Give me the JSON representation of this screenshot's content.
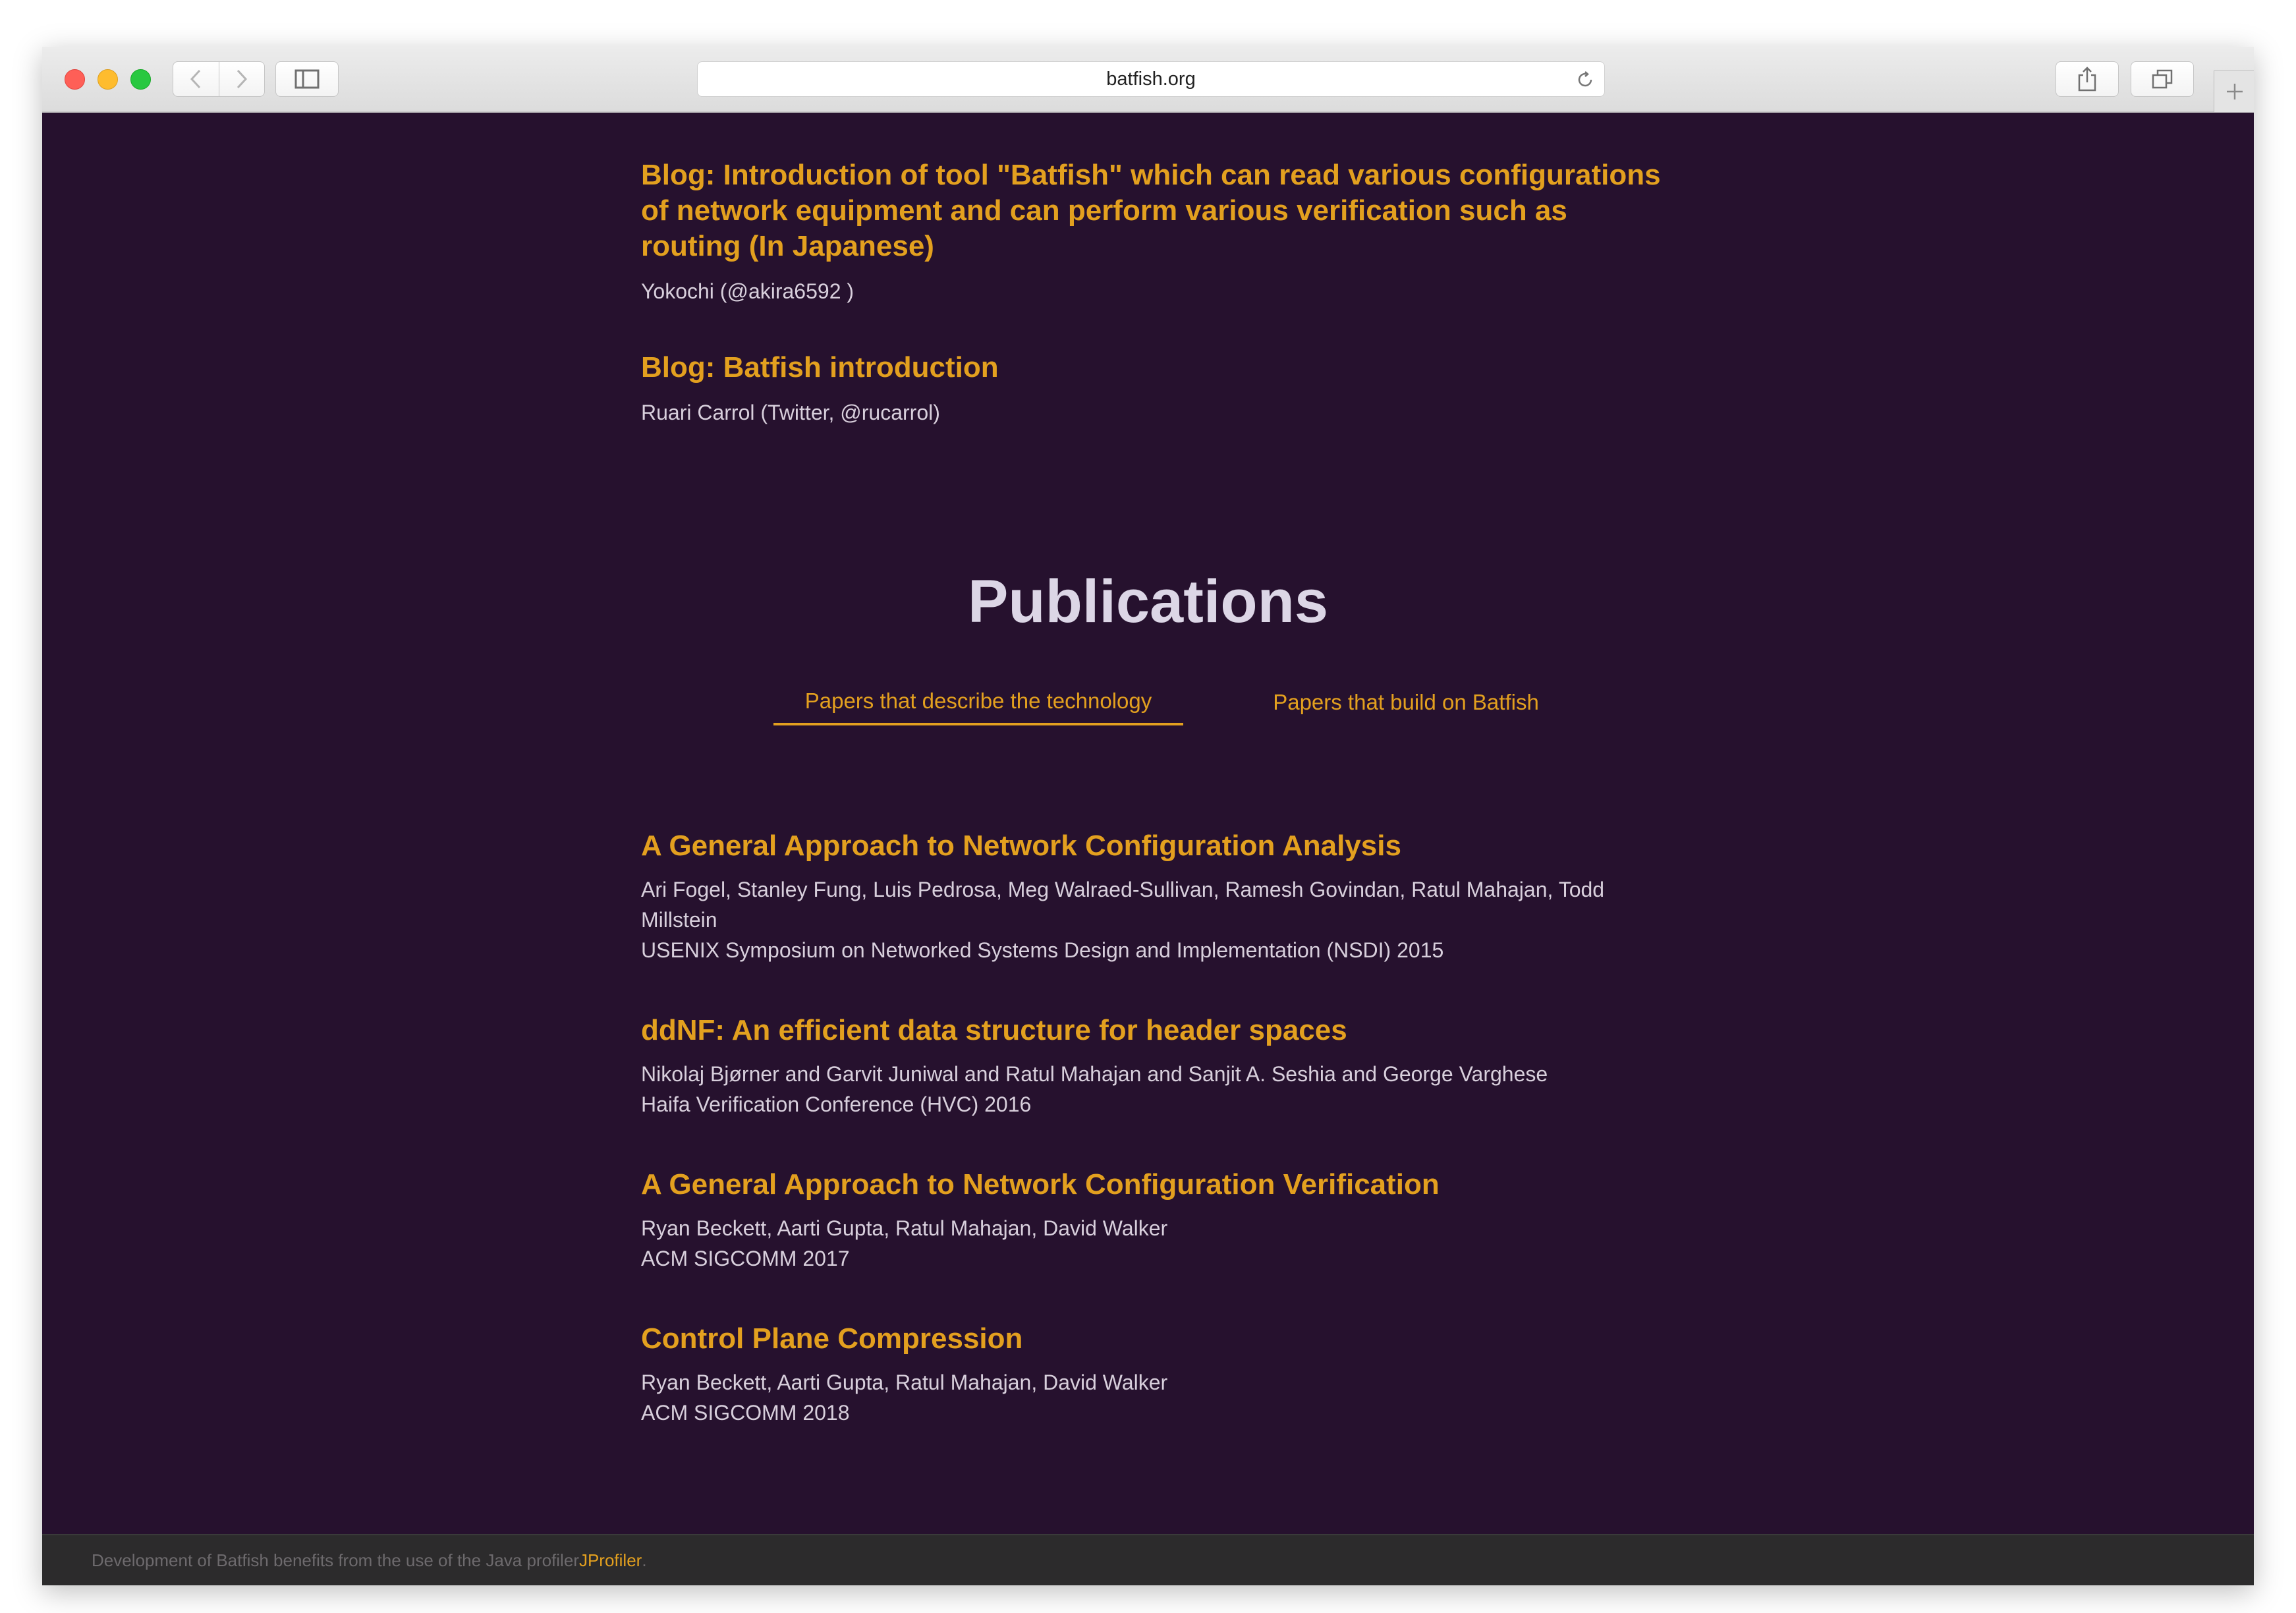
{
  "browser": {
    "url": "batfish.org"
  },
  "blog_posts": [
    {
      "title": "Blog: Introduction of tool \"Batfish\" which can read various configurations of network equipment and can perform various verification such as routing (In Japanese)",
      "author": "Yokochi (@akira6592 )"
    },
    {
      "title": "Blog: Batfish introduction",
      "author": "Ruari Carrol (Twitter, @rucarrol)"
    }
  ],
  "publications": {
    "heading": "Publications",
    "tabs": [
      {
        "label": "Papers that describe the technology",
        "active": true
      },
      {
        "label": "Papers that build on Batfish",
        "active": false
      }
    ],
    "papers": [
      {
        "title": "A General Approach to Network Configuration Analysis",
        "authors": "Ari Fogel, Stanley Fung, Luis Pedrosa, Meg Walraed-Sullivan, Ramesh Govindan, Ratul Mahajan, Todd Millstein",
        "venue": "USENIX Symposium on Networked Systems Design and Implementation (NSDI) 2015"
      },
      {
        "title": "ddNF: An efficient data structure for header spaces",
        "authors": "Nikolaj Bjørner and Garvit Juniwal and Ratul Mahajan and Sanjit A. Seshia and George Varghese",
        "venue": "Haifa Verification Conference (HVC) 2016"
      },
      {
        "title": "A General Approach to Network Configuration Verification",
        "authors": "Ryan Beckett, Aarti Gupta, Ratul Mahajan, David Walker",
        "venue": "ACM SIGCOMM 2017"
      },
      {
        "title": "Control Plane Compression",
        "authors": "Ryan Beckett, Aarti Gupta, Ratul Mahajan, David Walker",
        "venue": "ACM SIGCOMM 2018"
      }
    ]
  },
  "footer": {
    "text": "Development of Batfish benefits from the use of the Java profiler ",
    "link_label": "JProfiler",
    "trailing": "."
  },
  "colors": {
    "page_background": "#26112e",
    "accent": "#e3a01f",
    "footer_background": "#2c2b2c"
  }
}
